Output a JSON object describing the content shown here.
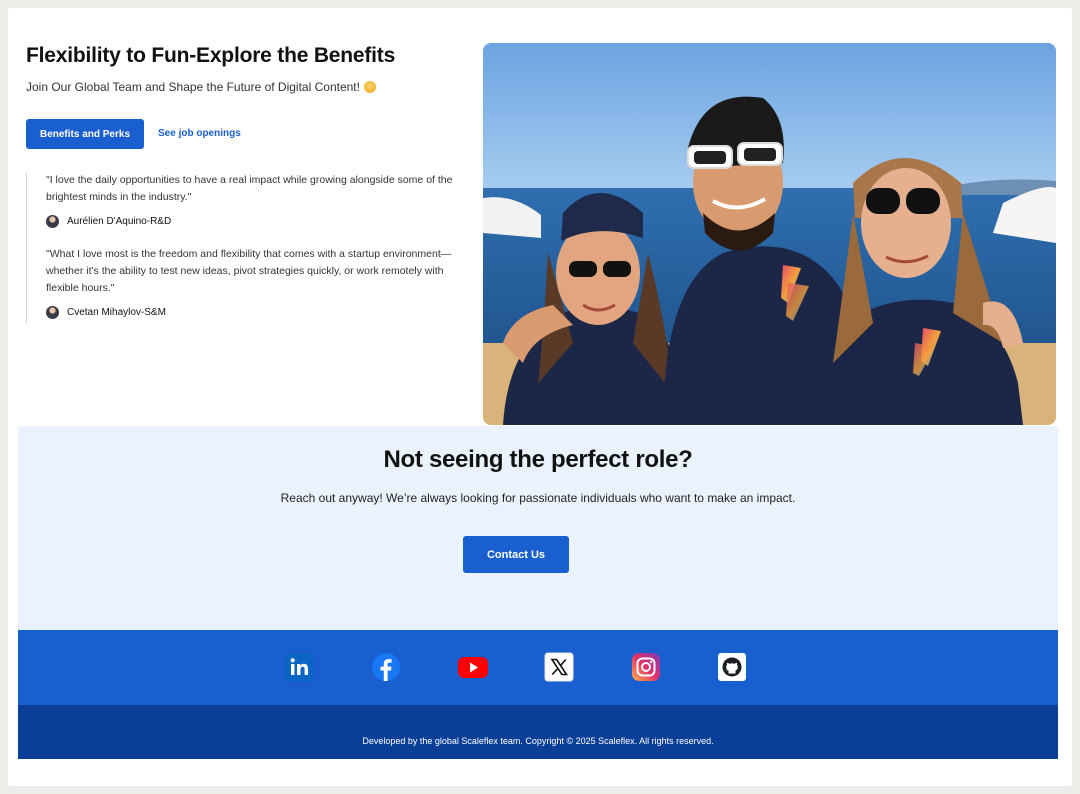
{
  "hero": {
    "title": "Flexibility to Fun-Explore the Benefits",
    "subtitle": "Join Our Global Team and Shape the Future of Digital Content!",
    "benefits_button": "Benefits and Perks",
    "jobs_link": "See job openings",
    "testimonials": [
      {
        "quote": "\"I love the daily opportunities to have a real impact while growing alongside some of the brightest minds in the industry.\"",
        "author": "Aurélien D'Aquino-R&D"
      },
      {
        "quote": "\"What I love most is the freedom and flexibility that comes with a startup environment—whether it's the ability to test new ideas, pivot strategies quickly, or work remotely with flexible hours.\"",
        "author": "Cvetan Mihaylov-S&M"
      }
    ]
  },
  "cta": {
    "title": "Not seeing the perfect role?",
    "text": "Reach out anyway! We’re always looking for passionate individuals who want to make an impact.",
    "button": "Contact Us"
  },
  "social": {
    "icons": [
      "linkedin-icon",
      "facebook-icon",
      "youtube-icon",
      "x-icon",
      "instagram-icon",
      "github-icon"
    ]
  },
  "footer": {
    "text": "Developed by the global Scaleflex team. Copyright © 2025 Scaleflex. All rights reserved."
  },
  "colors": {
    "primary": "#1a5fd0",
    "footer_dark": "#0a3f98",
    "cta_background": "#eaf3fd"
  }
}
